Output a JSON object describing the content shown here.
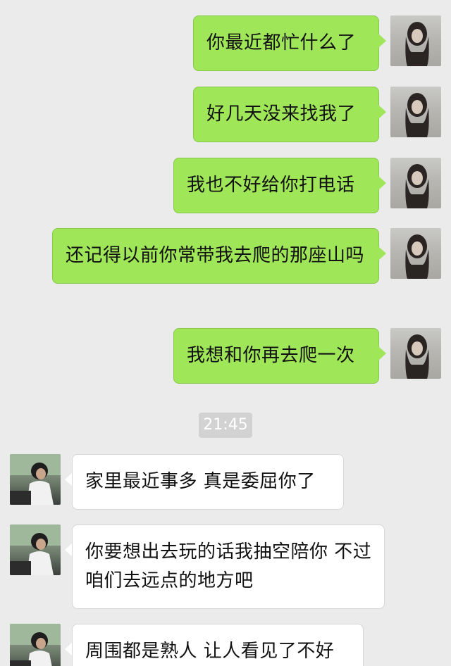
{
  "messages_sent": [
    {
      "text": "你最近都忙什么了"
    },
    {
      "text": "好几天没来找我了"
    },
    {
      "text": "我也不好给你打电话"
    },
    {
      "text": "还记得以前你常带我去爬的那座山吗"
    },
    {
      "text": "我想和你再去爬一次"
    }
  ],
  "timestamp": "21:45",
  "messages_received": [
    {
      "text": "家里最近事多 真是委屈你了"
    },
    {
      "text": "你要想出去玩的话我抽空陪你 不过咱们去远点的地方吧"
    },
    {
      "text": "周围都是熟人 让人看见了不好"
    }
  ],
  "colors": {
    "background": "#ebebeb",
    "sent_bubble": "#9fe658",
    "received_bubble": "#ffffff",
    "timestamp_bg": "#d2d2d2"
  },
  "icons": {
    "her_avatar": "avatar-photo-woman",
    "his_avatar": "avatar-photo-man-driving"
  }
}
